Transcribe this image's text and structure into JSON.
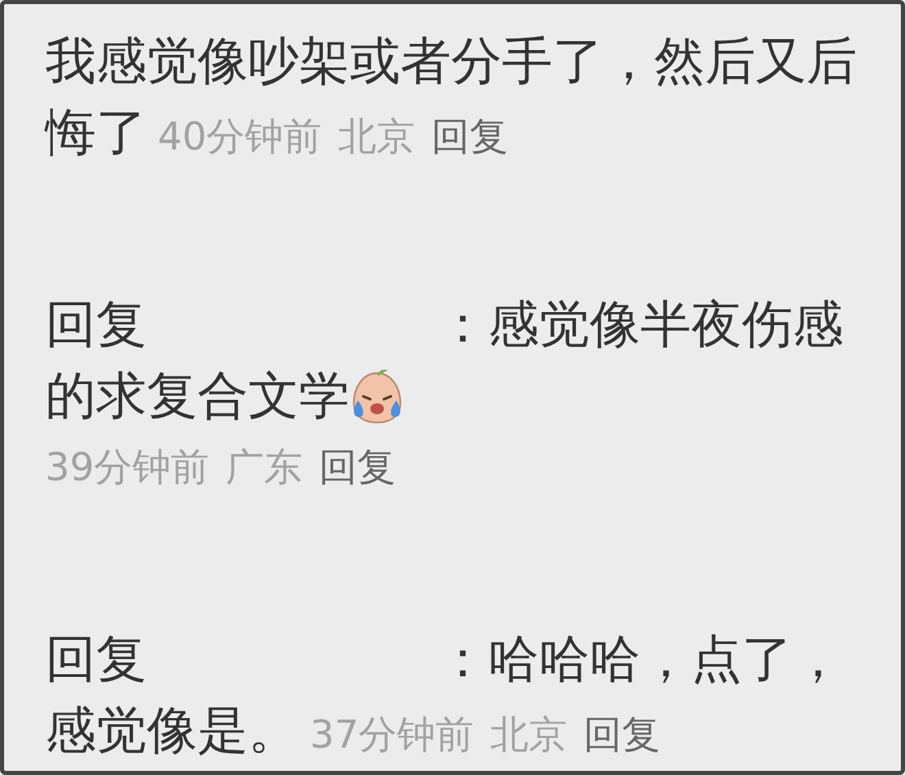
{
  "comments": [
    {
      "kind": "comment",
      "lines": [
        "我感觉像吵架或者分手了，然后又后",
        "悔了"
      ],
      "emoji": false,
      "meta_on_own_line": false,
      "time": "40分钟前",
      "location": "北京",
      "reply_label": "回复"
    },
    {
      "kind": "reply",
      "prefix": "回复",
      "colon": "：",
      "lines": [
        "感觉像半夜伤感",
        "的求复合文学"
      ],
      "emoji": true,
      "meta_on_own_line": true,
      "time": "39分钟前",
      "location": "广东",
      "reply_label": "回复"
    },
    {
      "kind": "reply",
      "prefix": "回复",
      "colon": "：",
      "lines": [
        "哈哈哈，点了，",
        "感觉像是。"
      ],
      "emoji": false,
      "meta_on_own_line": false,
      "time": "37分钟前",
      "location": "北京",
      "reply_label": "回复"
    }
  ]
}
